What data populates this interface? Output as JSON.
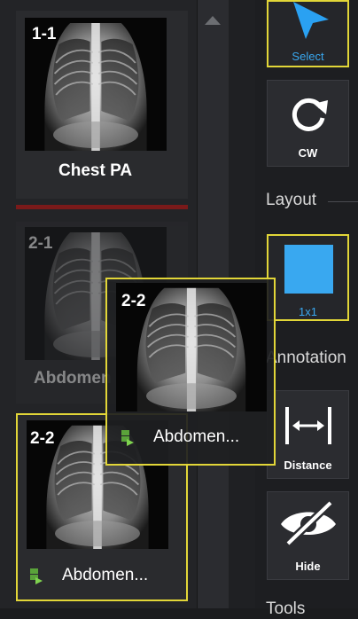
{
  "thumbnails": [
    {
      "index": "1-1",
      "caption": "Chest PA",
      "dimmed": false,
      "selected": false
    },
    {
      "index": "2-1",
      "caption": "Abdomen R",
      "dimmed": true,
      "selected": false
    },
    {
      "index": "2-2",
      "caption": "Abdomen...",
      "dimmed": false,
      "selected": true
    }
  ],
  "drag_ghost": {
    "index": "2-2",
    "caption": "Abdomen..."
  },
  "toolbar": {
    "select_label": "Select",
    "cw_label": "CW",
    "layout_section": "Layout",
    "layout_1x1_label": "1x1",
    "annotation_section": "Annotation",
    "distance_label": "Distance",
    "hide_label": "Hide",
    "tools_section": "Tools"
  },
  "colors": {
    "accent_selected": "#e2d638",
    "select_arrow": "#2aa1f2",
    "layout_tile": "#39a8f0",
    "separator_red": "#7a1a1a"
  },
  "icons": [
    "select-arrow-icon",
    "rotate-cw-icon",
    "layout-1x1-icon",
    "distance-icon",
    "hide-eye-icon",
    "series-icon"
  ]
}
